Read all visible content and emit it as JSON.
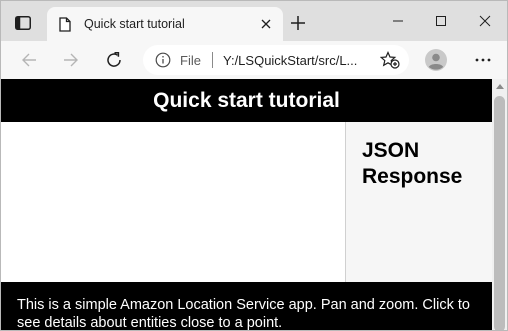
{
  "browser": {
    "tab": {
      "title": "Quick start tutorial",
      "favicon": "page-icon"
    },
    "toolbar": {
      "scheme_label": "File",
      "url": "Y:/LSQuickStart/src/L...",
      "icons": [
        "back-arrow-icon",
        "forward-arrow-icon",
        "reload-icon",
        "info-icon",
        "favorites-add-icon",
        "profile-icon",
        "more-icon"
      ]
    },
    "window_controls": [
      "minimize-icon",
      "maximize-icon",
      "close-icon"
    ]
  },
  "page": {
    "header_title": "Quick start tutorial",
    "json_panel_title": "JSON Response",
    "footer_text": "This is a simple Amazon Location Service app. Pan and zoom. Click to see details about entities close to a point."
  },
  "colors": {
    "header_bg": "#000000",
    "header_text": "#ffffff",
    "json_panel_bg": "#f6f6f6",
    "tabstrip_bg": "#dfdfdf",
    "toolbar_bg": "#f7f7f7"
  }
}
